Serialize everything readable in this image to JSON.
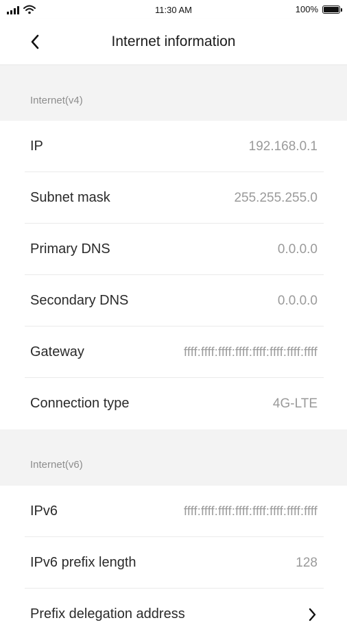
{
  "status_bar": {
    "time": "11:30 AM",
    "battery": "100%",
    "battery_level": 1.0,
    "icons": [
      "signal-icon",
      "wifi-icon",
      "battery-icon"
    ]
  },
  "header": {
    "title": "Internet information",
    "back_icon": "chevron-left-icon"
  },
  "sections": {
    "v4": {
      "title": "Internet(v4)",
      "rows": [
        {
          "label": "IP",
          "value": "192.168.0.1"
        },
        {
          "label": "Subnet mask",
          "value": "255.255.255.0"
        },
        {
          "label": "Primary DNS",
          "value": "0.0.0.0"
        },
        {
          "label": "Secondary DNS",
          "value": "0.0.0.0"
        },
        {
          "label": "Gateway",
          "value": "ffff:ffff:ffff:ffff:ffff:ffff:ffff:ffff"
        },
        {
          "label": "Connection type",
          "value": "4G-LTE"
        }
      ]
    },
    "v6": {
      "title": "Internet(v6)",
      "rows": [
        {
          "label": "IPv6",
          "value": "ffff:ffff:ffff:ffff:ffff:ffff:ffff:ffff"
        },
        {
          "label": "IPv6 prefix length",
          "value": "128"
        },
        {
          "label": "Prefix delegation address",
          "value": ""
        }
      ]
    }
  },
  "colors": {
    "background": "#f3f3f3",
    "card": "#ffffff",
    "label_text": "#2a2a2a",
    "value_text": "#9a9a9a",
    "section_text": "#8d8d8d"
  }
}
